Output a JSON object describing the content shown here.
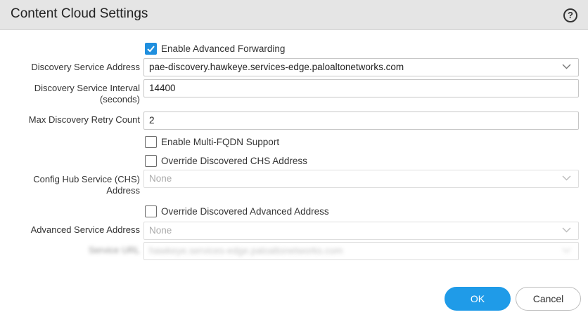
{
  "dialog": {
    "title": "Content Cloud Settings",
    "help_icon": "question-circle-icon",
    "help_glyph": "?"
  },
  "enable_advanced_forwarding": {
    "label": "Enable Advanced Forwarding",
    "checked": true
  },
  "discovery_service_address": {
    "label": "Discovery Service Address",
    "value": "pae-discovery.hawkeye.services-edge.paloaltonetworks.com"
  },
  "discovery_service_interval": {
    "label_line1": "Discovery Service Interval",
    "label_line2": "(seconds)",
    "value": "14400"
  },
  "max_discovery_retry_count": {
    "label": "Max Discovery Retry Count",
    "value": "2"
  },
  "enable_multi_fqdn": {
    "label": "Enable Multi-FQDN Support",
    "checked": false
  },
  "override_chs": {
    "label": "Override Discovered CHS Address",
    "checked": false
  },
  "config_hub_service": {
    "label_line1": "Config Hub Service (CHS)",
    "label_line2": "Address",
    "placeholder": "None"
  },
  "override_advanced": {
    "label": "Override Discovered Advanced Address",
    "checked": false
  },
  "advanced_service_address": {
    "label": "Advanced Service Address",
    "placeholder": "None"
  },
  "service_url": {
    "label": "Service URL",
    "value": "hawkeye.services-edge.paloaltonetworks.com"
  },
  "footer": {
    "ok_label": "OK",
    "cancel_label": "Cancel"
  },
  "colors": {
    "accent": "#1f9be8",
    "checkbox_checked": "#1f8fde",
    "titlebar": "#e5e5e5"
  }
}
